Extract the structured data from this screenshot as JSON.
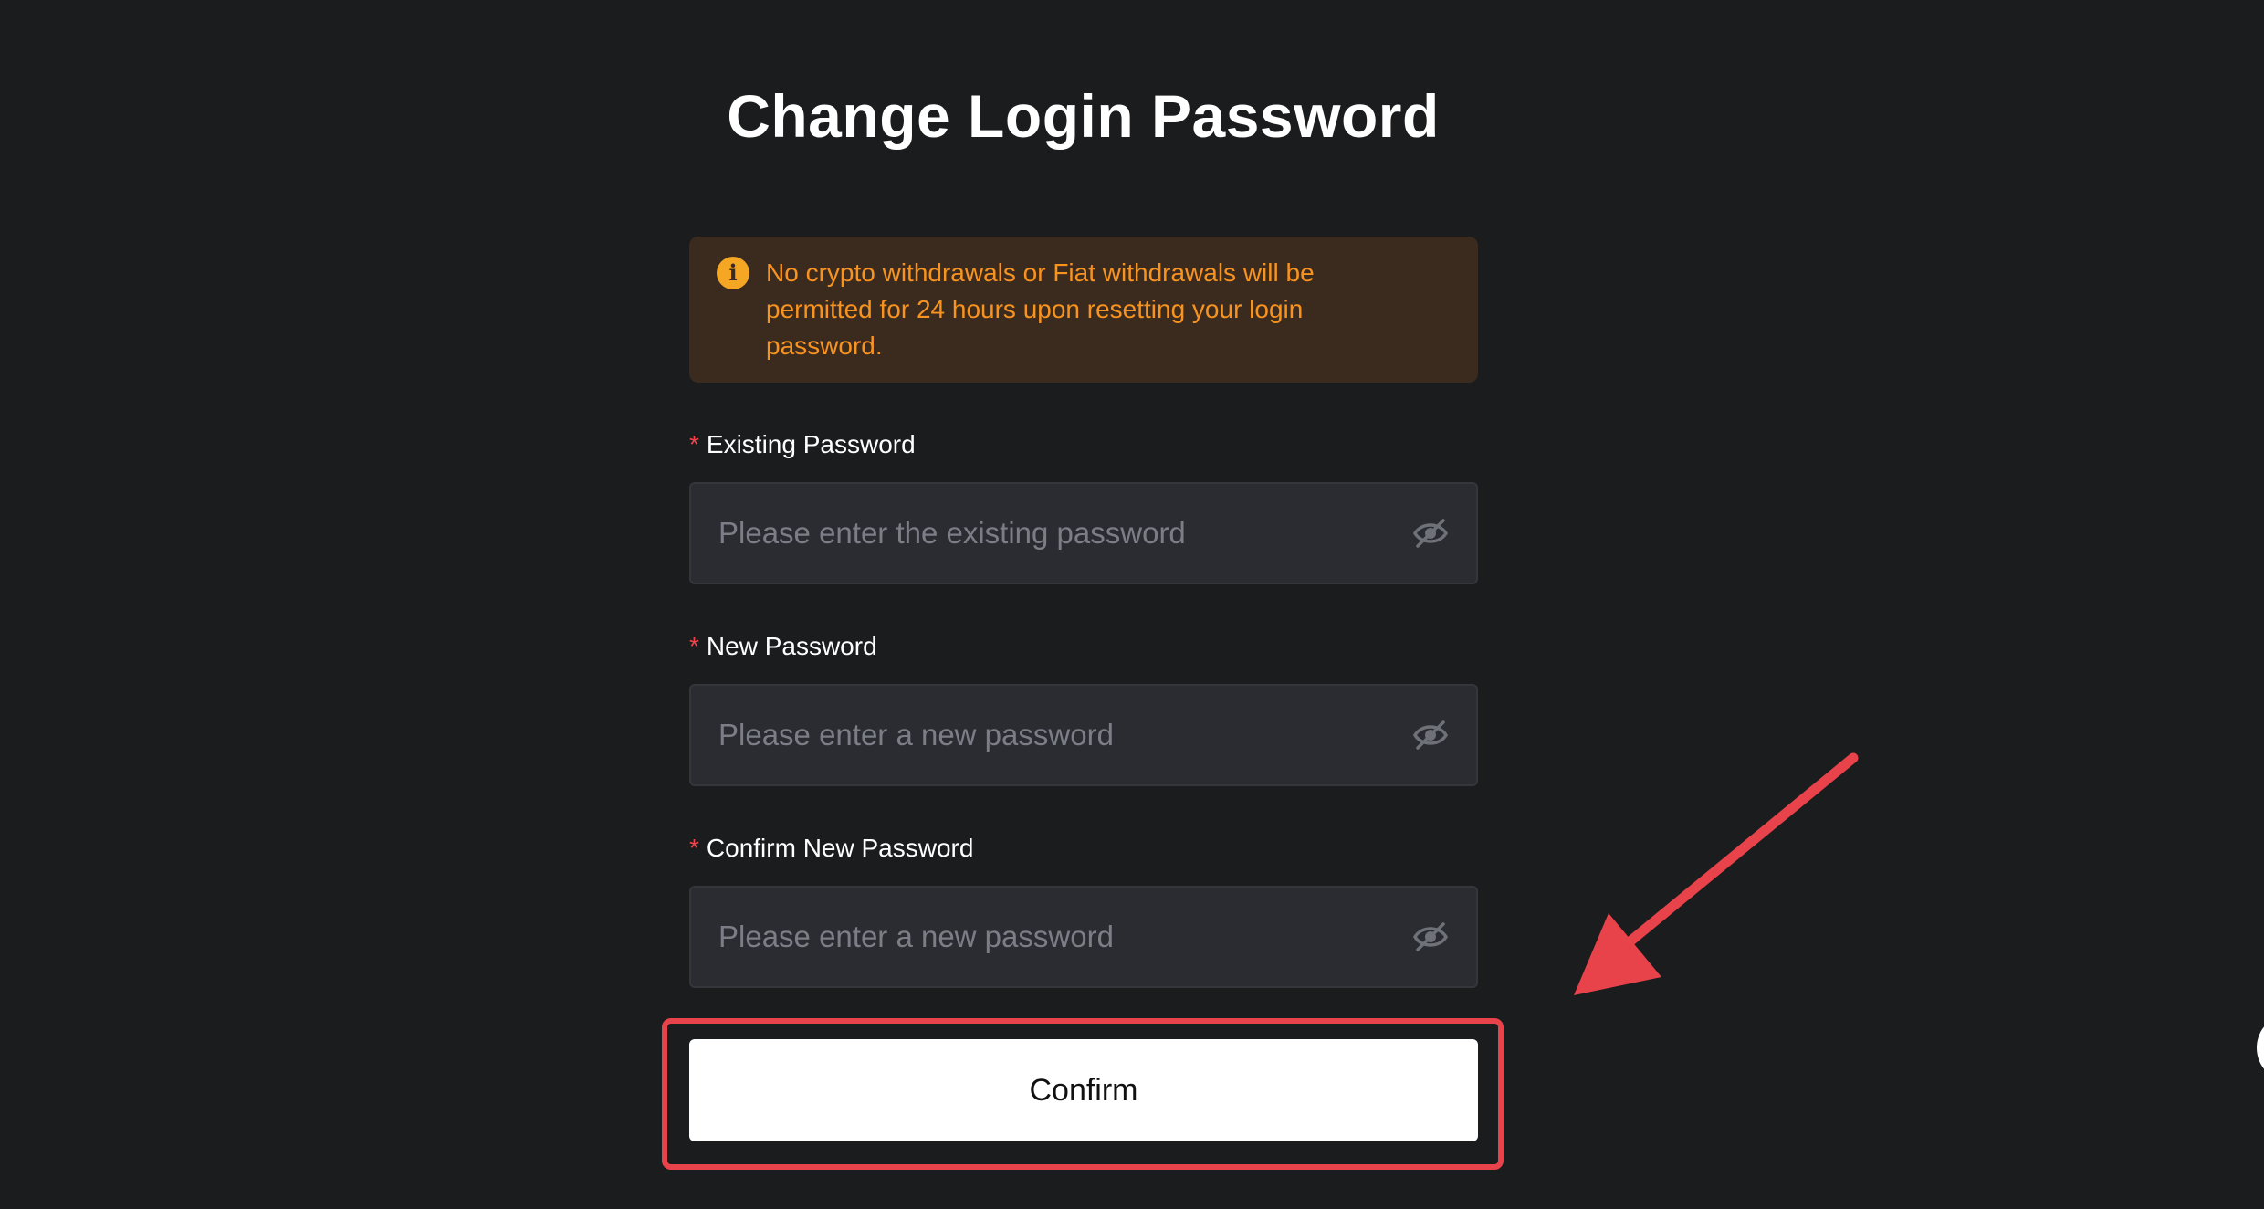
{
  "page": {
    "title": "Change Login Password"
  },
  "notice": {
    "icon": "info-icon",
    "icon_glyph": "i",
    "text": "No crypto withdrawals or Fiat withdrawals will be permitted for 24 hours upon resetting your login password.",
    "color": "#f7931e"
  },
  "fields": {
    "existing": {
      "required_mark": "*",
      "label": "Existing Password",
      "placeholder": "Please enter the existing password",
      "value": ""
    },
    "new": {
      "required_mark": "*",
      "label": "New Password",
      "placeholder": "Please enter a new password",
      "value": ""
    },
    "confirm": {
      "required_mark": "*",
      "label": "Confirm New Password",
      "placeholder": "Please enter a new password",
      "value": ""
    }
  },
  "actions": {
    "confirm_label": "Confirm"
  },
  "annotations": {
    "highlight_color": "#e8424a",
    "arrow_color": "#e8424a"
  }
}
